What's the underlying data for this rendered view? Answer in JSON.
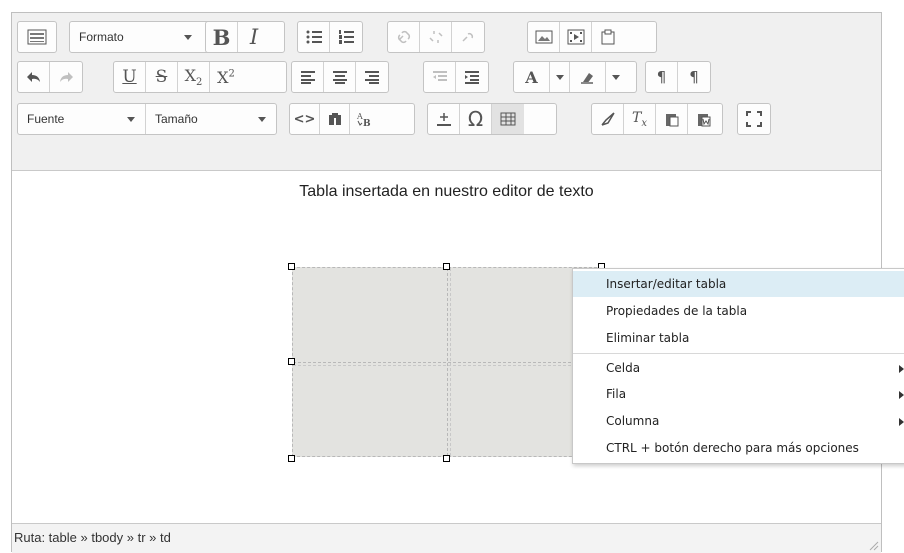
{
  "toolbar": {
    "format_label": "Formato",
    "font_label": "Fuente",
    "size_label": "Tamaño",
    "bold": "B",
    "italic": "I",
    "underline": "U",
    "strike": "S",
    "subscript": "X",
    "subscript_mark": "2",
    "superscript": "X",
    "superscript_mark": "2",
    "font_color": "A",
    "omega": "Ω",
    "clear_format": "T",
    "clear_format_mark": "x",
    "code": "<>",
    "pilcrow": "¶"
  },
  "content": {
    "heading": "Tabla insertada en nuestro editor de texto"
  },
  "status": {
    "path": "Ruta: table » tbody » tr » td"
  },
  "context_menu": {
    "items": [
      {
        "label": "Insertar/editar tabla"
      },
      {
        "label": "Propiedades de la tabla"
      },
      {
        "label": "Eliminar tabla"
      },
      {
        "label": "Celda"
      },
      {
        "label": "Fila"
      },
      {
        "label": "Columna"
      },
      {
        "label": "CTRL + botón derecho para más opciones"
      }
    ]
  },
  "colors": {
    "toolbar_bg": "#f0f0f0",
    "table_cell_bg": "#e3e3e0",
    "menu_highlight": "#dcedf5"
  }
}
